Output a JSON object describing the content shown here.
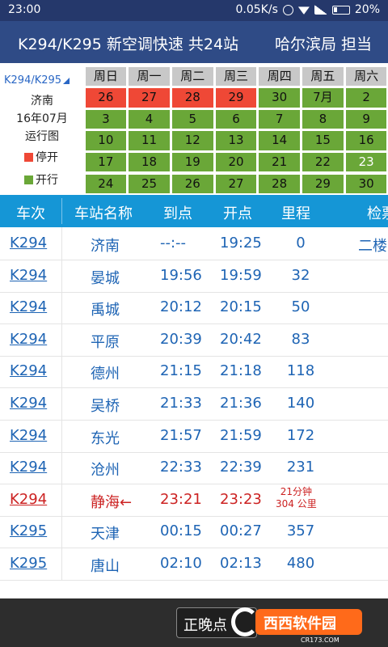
{
  "status": {
    "time": "23:00",
    "speed": "0.05K/s",
    "battery": "20%"
  },
  "header": {
    "title": "K294/K295 新空调快速 共24站",
    "bureau": "哈尔滨局 担当"
  },
  "calendar": {
    "train": "K294/K295",
    "station": "济南",
    "month": "16年07月",
    "chart": "运行图",
    "legend_stop": "停开",
    "legend_run": "开行",
    "colors": {
      "stop": "#ef4836",
      "run": "#6aa738",
      "head": "#c8c8c8"
    },
    "weekdays": [
      "周日",
      "周一",
      "周二",
      "周三",
      "周四",
      "周五",
      "周六"
    ],
    "weeks": [
      [
        {
          "d": "26",
          "s": "red"
        },
        {
          "d": "27",
          "s": "red"
        },
        {
          "d": "28",
          "s": "red"
        },
        {
          "d": "29",
          "s": "red"
        },
        {
          "d": "30",
          "s": "green"
        },
        {
          "d": "7月",
          "s": "green"
        },
        {
          "d": "2",
          "s": "green"
        }
      ],
      [
        {
          "d": "3",
          "s": "green"
        },
        {
          "d": "4",
          "s": "green"
        },
        {
          "d": "5",
          "s": "green"
        },
        {
          "d": "6",
          "s": "green"
        },
        {
          "d": "7",
          "s": "green"
        },
        {
          "d": "8",
          "s": "green"
        },
        {
          "d": "9",
          "s": "green"
        }
      ],
      [
        {
          "d": "10",
          "s": "green"
        },
        {
          "d": "11",
          "s": "green"
        },
        {
          "d": "12",
          "s": "green"
        },
        {
          "d": "13",
          "s": "green"
        },
        {
          "d": "14",
          "s": "green"
        },
        {
          "d": "15",
          "s": "green"
        },
        {
          "d": "16",
          "s": "green"
        }
      ],
      [
        {
          "d": "17",
          "s": "green"
        },
        {
          "d": "18",
          "s": "green"
        },
        {
          "d": "19",
          "s": "green"
        },
        {
          "d": "20",
          "s": "green"
        },
        {
          "d": "21",
          "s": "green"
        },
        {
          "d": "22",
          "s": "green"
        },
        {
          "d": "23",
          "s": "green",
          "light": true
        }
      ],
      [
        {
          "d": "24",
          "s": "green"
        },
        {
          "d": "25",
          "s": "green"
        },
        {
          "d": "26",
          "s": "green"
        },
        {
          "d": "27",
          "s": "green"
        },
        {
          "d": "28",
          "s": "green"
        },
        {
          "d": "29",
          "s": "green"
        },
        {
          "d": "30",
          "s": "green"
        }
      ]
    ]
  },
  "table": {
    "headers": {
      "code": "车次",
      "station": "车站名称",
      "arrive": "到点",
      "depart": "开点",
      "dist": "里程",
      "check": "检票"
    },
    "rows": [
      {
        "code": "K294",
        "station": "济南",
        "arrive": "--:--",
        "depart": "19:25",
        "dist": "0",
        "check": "二楼"
      },
      {
        "code": "K294",
        "station": "晏城",
        "arrive": "19:56",
        "depart": "19:59",
        "dist": "32",
        "check": ""
      },
      {
        "code": "K294",
        "station": "禹城",
        "arrive": "20:12",
        "depart": "20:15",
        "dist": "50",
        "check": ""
      },
      {
        "code": "K294",
        "station": "平原",
        "arrive": "20:39",
        "depart": "20:42",
        "dist": "83",
        "check": ""
      },
      {
        "code": "K294",
        "station": "德州",
        "arrive": "21:15",
        "depart": "21:18",
        "dist": "118",
        "check": ""
      },
      {
        "code": "K294",
        "station": "吴桥",
        "arrive": "21:33",
        "depart": "21:36",
        "dist": "140",
        "check": ""
      },
      {
        "code": "K294",
        "station": "东光",
        "arrive": "21:57",
        "depart": "21:59",
        "dist": "172",
        "check": ""
      },
      {
        "code": "K294",
        "station": "沧州",
        "arrive": "22:33",
        "depart": "22:39",
        "dist": "231",
        "check": ""
      },
      {
        "code": "K294",
        "station": "静海←",
        "arrive": "23:21",
        "depart": "23:23",
        "dist": "21分钟\n304 公里",
        "check": "",
        "highlight": true
      },
      {
        "code": "K295",
        "station": "天津",
        "arrive": "00:15",
        "depart": "00:27",
        "dist": "357",
        "check": ""
      },
      {
        "code": "K295",
        "station": "唐山",
        "arrive": "02:10",
        "depart": "02:13",
        "dist": "480",
        "check": ""
      }
    ]
  },
  "bottom": {
    "button": "正晚点"
  },
  "watermark": {
    "text": "西西软件园",
    "sub": "CR173.COM"
  }
}
